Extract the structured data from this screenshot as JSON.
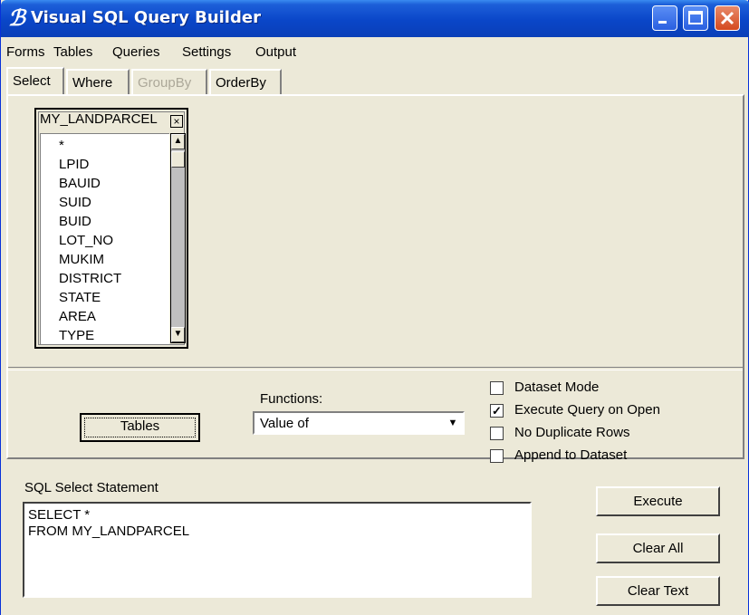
{
  "window": {
    "title": "Visual SQL Query Builder"
  },
  "menu": [
    "Forms",
    "Tables",
    "Queries",
    "Settings",
    "Output"
  ],
  "tabs": [
    {
      "label": "Select",
      "state": "active"
    },
    {
      "label": "Where",
      "state": "normal"
    },
    {
      "label": "GroupBy",
      "state": "disabled"
    },
    {
      "label": "OrderBy",
      "state": "normal"
    }
  ],
  "table_box": {
    "title": "MY_LANDPARCEL",
    "fields": [
      "*",
      "LPID",
      "BAUID",
      "SUID",
      "BUID",
      "LOT_NO",
      "MUKIM",
      "DISTRICT",
      "STATE",
      "AREA",
      "TYPE"
    ]
  },
  "controls": {
    "tables_button": "Tables",
    "functions_label": "Functions:",
    "functions_value": "Value of"
  },
  "options": [
    {
      "label": "Dataset Mode",
      "checked": false
    },
    {
      "label": "Execute Query on Open",
      "checked": true
    },
    {
      "label": "No Duplicate Rows",
      "checked": false
    },
    {
      "label": "Append to Dataset",
      "checked": false
    }
  ],
  "sql": {
    "label": "SQL Select Statement",
    "lines": [
      "SELECT *",
      "FROM MY_LANDPARCEL"
    ]
  },
  "buttons": {
    "execute": "Execute",
    "clear_all": "Clear All",
    "clear_text": "Clear Text"
  }
}
